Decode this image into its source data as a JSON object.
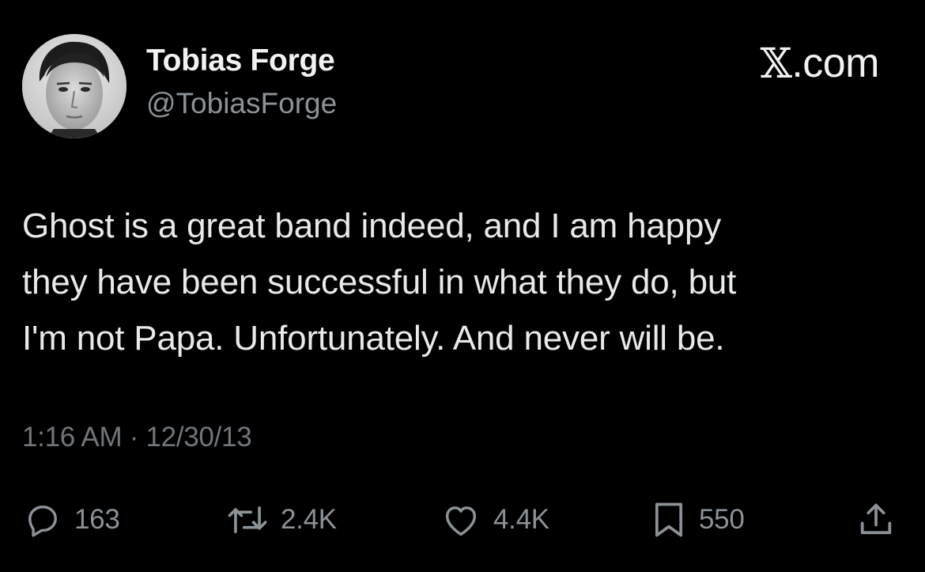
{
  "author": {
    "display_name": "Tobias Forge",
    "handle": "@TobiasForge"
  },
  "site_mark": {
    "glyph": "𝕏",
    "suffix": ".com"
  },
  "tweet": {
    "text": "Ghost is a great band indeed, and I am happy\nthey have been successful in what they do, but\nI'm not Papa. Unfortunately. And never will be.",
    "timestamp": "1:16 AM · 12/30/13"
  },
  "actions": {
    "replies": {
      "icon": "reply-icon",
      "count": "163"
    },
    "reposts": {
      "icon": "repost-icon",
      "count": "2.4K"
    },
    "likes": {
      "icon": "heart-icon",
      "count": "4.4K"
    },
    "bookmarks": {
      "icon": "bookmark-icon",
      "count": "550"
    },
    "share": {
      "icon": "share-icon"
    }
  },
  "colors": {
    "background": "#000000",
    "text_primary": "#e7e9ea",
    "text_secondary": "#71767b",
    "icon": "#8b9298"
  }
}
